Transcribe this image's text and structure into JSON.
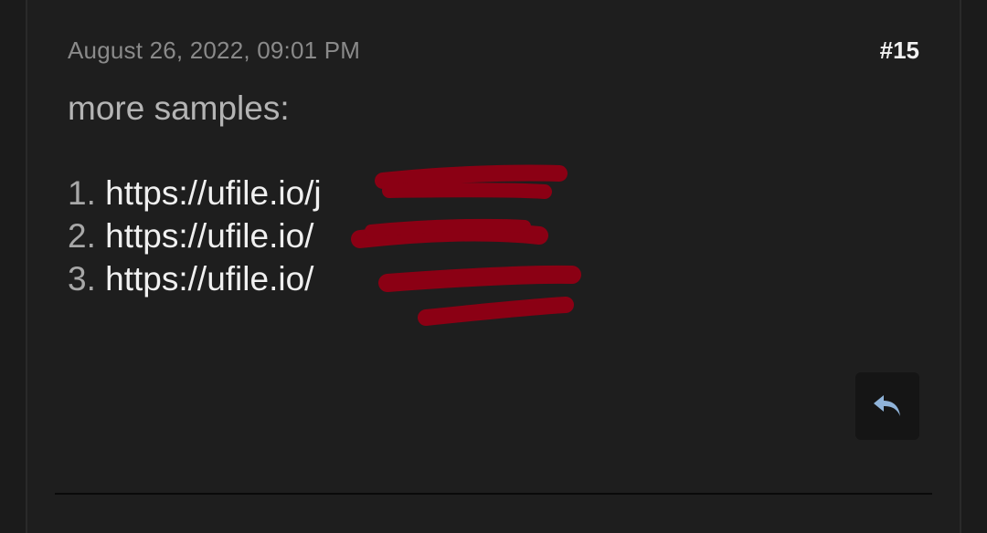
{
  "post": {
    "date": "August 26, 2022, 09:01 PM",
    "number": "#15",
    "intro": "more samples:",
    "links": [
      {
        "num": "1.",
        "url": "https://ufile.io/j"
      },
      {
        "num": "2.",
        "url": "https://ufile.io/"
      },
      {
        "num": "3.",
        "url": "https://ufile.io/"
      }
    ]
  },
  "colors": {
    "background": "#1e1e1e",
    "redaction": "#8b0014",
    "reply_icon": "#8fb3d9"
  },
  "icons": {
    "reply": "reply-arrow-icon"
  }
}
